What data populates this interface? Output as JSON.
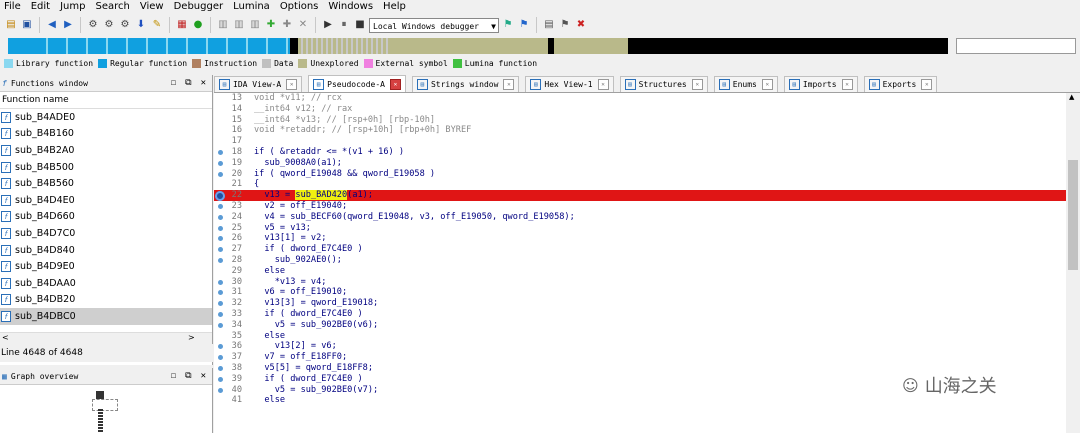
{
  "menu": [
    "File",
    "Edit",
    "Jump",
    "Search",
    "View",
    "Debugger",
    "Lumina",
    "Options",
    "Windows",
    "Help"
  ],
  "toolbar": {
    "debugger": "Local Windows debugger"
  },
  "legend": [
    {
      "label": "Library function",
      "color": "#8ad8f0"
    },
    {
      "label": "Regular function",
      "color": "#10a0e0"
    },
    {
      "label": "Instruction",
      "color": "#b08060"
    },
    {
      "label": "Data",
      "color": "#c0c0c0"
    },
    {
      "label": "Unexplored",
      "color": "#b9b98a"
    },
    {
      "label": "External symbol",
      "color": "#f080e0"
    },
    {
      "label": "Lumina function",
      "color": "#40c040"
    }
  ],
  "functions_panel": {
    "title": "Functions window",
    "column": "Function name",
    "items": [
      "sub_B4ADE0",
      "sub_B4B160",
      "sub_B4B2A0",
      "sub_B4B500",
      "sub_B4B560",
      "sub_B4D4E0",
      "sub_B4D660",
      "sub_B4D7C0",
      "sub_B4D840",
      "sub_B4D9E0",
      "sub_B4DAA0",
      "sub_B4DB20",
      "sub_B4DBC0"
    ],
    "selected": 12,
    "status": "Line 4648 of 4648"
  },
  "graph_panel": {
    "title": "Graph overview"
  },
  "tabs": [
    {
      "label": "IDA View-A",
      "active": false
    },
    {
      "label": "Pseudocode-A",
      "active": true
    },
    {
      "label": "Strings window",
      "active": false
    },
    {
      "label": "Hex View-1",
      "active": false
    },
    {
      "label": "Structures",
      "active": false
    },
    {
      "label": "Enums",
      "active": false
    },
    {
      "label": "Imports",
      "active": false
    },
    {
      "label": "Exports",
      "active": false
    }
  ],
  "code": [
    {
      "n": "13",
      "t": "void *v11; // rcx",
      "c": true,
      "d": false
    },
    {
      "n": "14",
      "t": "__int64 v12; // rax",
      "c": true,
      "d": false
    },
    {
      "n": "15",
      "t": "__int64 *v13; // [rsp+0h] [rbp-10h]",
      "c": true,
      "d": false
    },
    {
      "n": "16",
      "t": "void *retaddr; // [rsp+10h] [rbp+0h] BYREF",
      "c": true,
      "d": false
    },
    {
      "n": "17",
      "t": "",
      "c": false,
      "d": false
    },
    {
      "n": "18",
      "t": "if ( &retaddr <= *(v1 + 16) )",
      "c": false,
      "d": true
    },
    {
      "n": "19",
      "t": "  sub_9008A0(a1);",
      "c": false,
      "d": true
    },
    {
      "n": "20",
      "t": "if ( qword_E19048 && qword_E19058 )",
      "c": false,
      "d": true
    },
    {
      "n": "21",
      "t": "{",
      "c": false,
      "d": false
    },
    {
      "n": "22",
      "t": "  v13 = sub_BAD420(a1);",
      "c": false,
      "d": false,
      "hl": true
    },
    {
      "n": "23",
      "t": "  v2 = off_E19040;",
      "c": false,
      "d": true
    },
    {
      "n": "24",
      "t": "  v4 = sub_BECF60(qword_E19048, v3, off_E19050, qword_E19058);",
      "c": false,
      "d": true
    },
    {
      "n": "25",
      "t": "  v5 = v13;",
      "c": false,
      "d": true
    },
    {
      "n": "26",
      "t": "  v13[1] = v2;",
      "c": false,
      "d": true
    },
    {
      "n": "27",
      "t": "  if ( dword_E7C4E0 )",
      "c": false,
      "d": true
    },
    {
      "n": "28",
      "t": "    sub_902AE0();",
      "c": false,
      "d": true
    },
    {
      "n": "29",
      "t": "  else",
      "c": false,
      "d": false
    },
    {
      "n": "30",
      "t": "    *v13 = v4;",
      "c": false,
      "d": true
    },
    {
      "n": "31",
      "t": "  v6 = off_E19010;",
      "c": false,
      "d": true
    },
    {
      "n": "32",
      "t": "  v13[3] = qword_E19018;",
      "c": false,
      "d": true
    },
    {
      "n": "33",
      "t": "  if ( dword_E7C4E0 )",
      "c": false,
      "d": true
    },
    {
      "n": "34",
      "t": "    v5 = sub_902BE0(v6);",
      "c": false,
      "d": true
    },
    {
      "n": "35",
      "t": "  else",
      "c": false,
      "d": false
    },
    {
      "n": "36",
      "t": "    v13[2] = v6;",
      "c": false,
      "d": true
    },
    {
      "n": "37",
      "t": "  v7 = off_E18FF0;",
      "c": false,
      "d": true
    },
    {
      "n": "38",
      "t": "  v5[5] = qword_E18FF8;",
      "c": false,
      "d": true
    },
    {
      "n": "39",
      "t": "  if ( dword_E7C4E0 )",
      "c": false,
      "d": true
    },
    {
      "n": "40",
      "t": "    v5 = sub_902BE0(v7);",
      "c": false,
      "d": true
    },
    {
      "n": "41",
      "t": "  else",
      "c": false,
      "d": false
    }
  ],
  "watermark": "山海之关"
}
